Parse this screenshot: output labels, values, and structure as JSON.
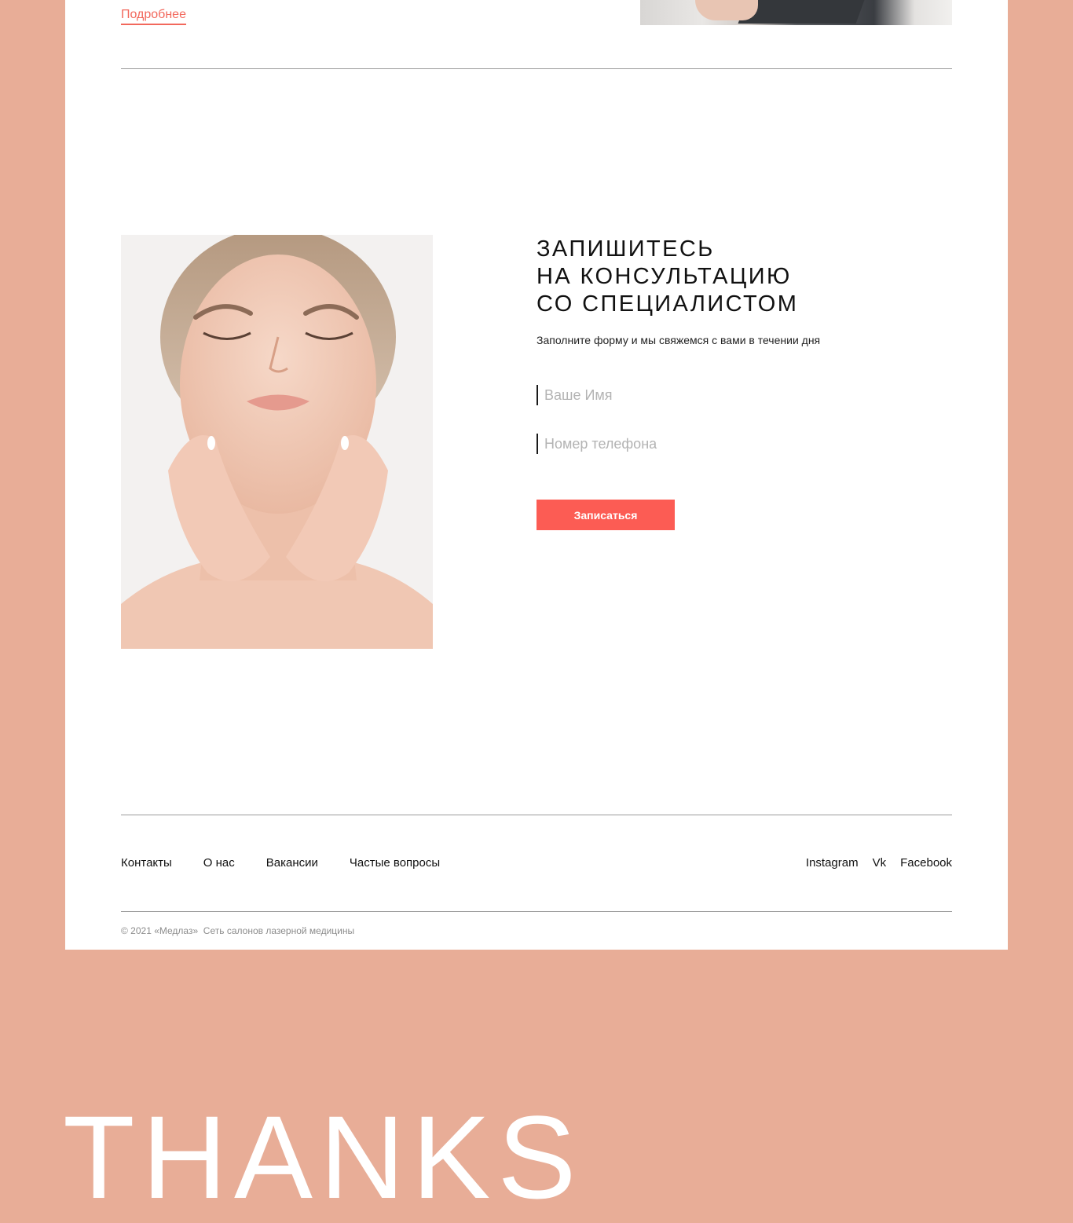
{
  "top": {
    "more_link": "Подробнее"
  },
  "form": {
    "title_lines": [
      "ЗАПИШИТЕСЬ",
      "НА КОНСУЛЬТАЦИЮ",
      "СО СПЕЦИАЛИСТОМ"
    ],
    "subtitle": "Заполните форму и мы свяжемся с вами в течении дня",
    "name_placeholder": "Ваше Имя",
    "phone_placeholder": "Номер телефона",
    "submit_label": "Записаться"
  },
  "footer": {
    "nav": [
      "Контакты",
      "О нас",
      "Вакансии",
      "Частые вопросы"
    ],
    "social": [
      "Instagram",
      "Vk",
      "Facebook"
    ],
    "copyright": "© 2021 «Медлаз»  Сеть салонов лазерной медицины"
  },
  "thanks": "THANKS",
  "colors": {
    "background": "#e8ad97",
    "accent": "#fc5c54",
    "link": "#f2685c"
  }
}
